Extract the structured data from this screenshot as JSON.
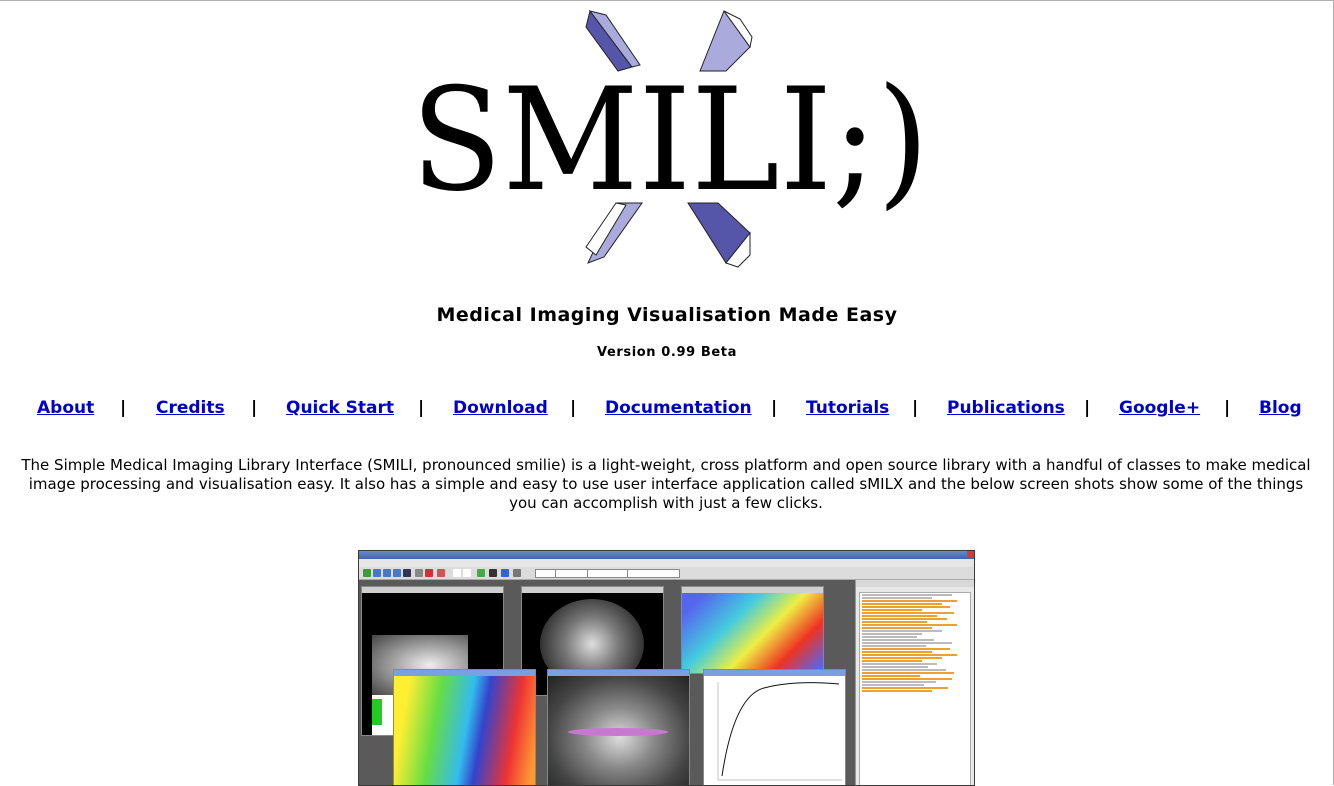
{
  "logo": {
    "text": "SMILI;)"
  },
  "tagline": "Medical Imaging Visualisation Made Easy",
  "version": "Version 0.99 Beta",
  "nav": {
    "separator": "|",
    "items": [
      {
        "label": "About"
      },
      {
        "label": "Credits"
      },
      {
        "label": "Quick Start"
      },
      {
        "label": "Download"
      },
      {
        "label": "Documentation"
      },
      {
        "label": "Tutorials"
      },
      {
        "label": "Publications"
      },
      {
        "label": "Google+"
      },
      {
        "label": "Blog"
      }
    ]
  },
  "intro": "The Simple Medical Imaging Library Interface (SMILI, pronounced smilie) is a light-weight, cross platform and open source library with a handful of classes to make medical image processing and visualisation easy. It also has a simple and easy to use user interface application called sMILX and the below screen shots show some of the things you can accomplish with just a few clicks.",
  "colors": {
    "link": "#0000cc",
    "logo_bar_light": "#aaaadd",
    "logo_bar_dark": "#5555aa"
  }
}
